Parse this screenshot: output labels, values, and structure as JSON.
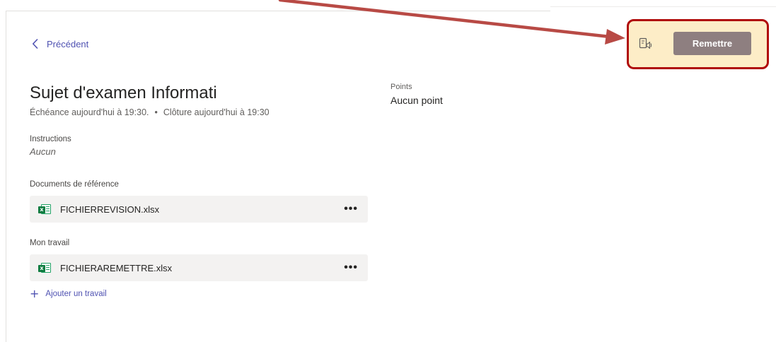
{
  "nav": {
    "back_label": "Précédent"
  },
  "assignment": {
    "title": "Sujet d'examen Informati",
    "due": "Échéance aujourd'hui à 19:30.",
    "separator": "•",
    "close": "Clôture aujourd'hui à 19:30"
  },
  "points": {
    "label": "Points",
    "value": "Aucun point"
  },
  "instructions": {
    "label": "Instructions",
    "value": "Aucun"
  },
  "reference_docs": {
    "label": "Documents de référence",
    "files": [
      {
        "name": "FICHIERREVISION.xlsx",
        "icon": "excel-file-icon"
      }
    ]
  },
  "my_work": {
    "label": "Mon travail",
    "files": [
      {
        "name": "FICHIERAREMETTRE.xlsx",
        "icon": "excel-file-icon"
      }
    ],
    "add_label": "Ajouter un travail"
  },
  "toolbar": {
    "submit_label": "Remettre",
    "immersive_icon": "immersive-reader-icon"
  },
  "colors": {
    "accent": "#4f52b2",
    "submit_bg": "#8e7f80",
    "highlight_bg": "#fdedc7",
    "highlight_border": "#b00b0b",
    "arrow": "#b84a45"
  }
}
